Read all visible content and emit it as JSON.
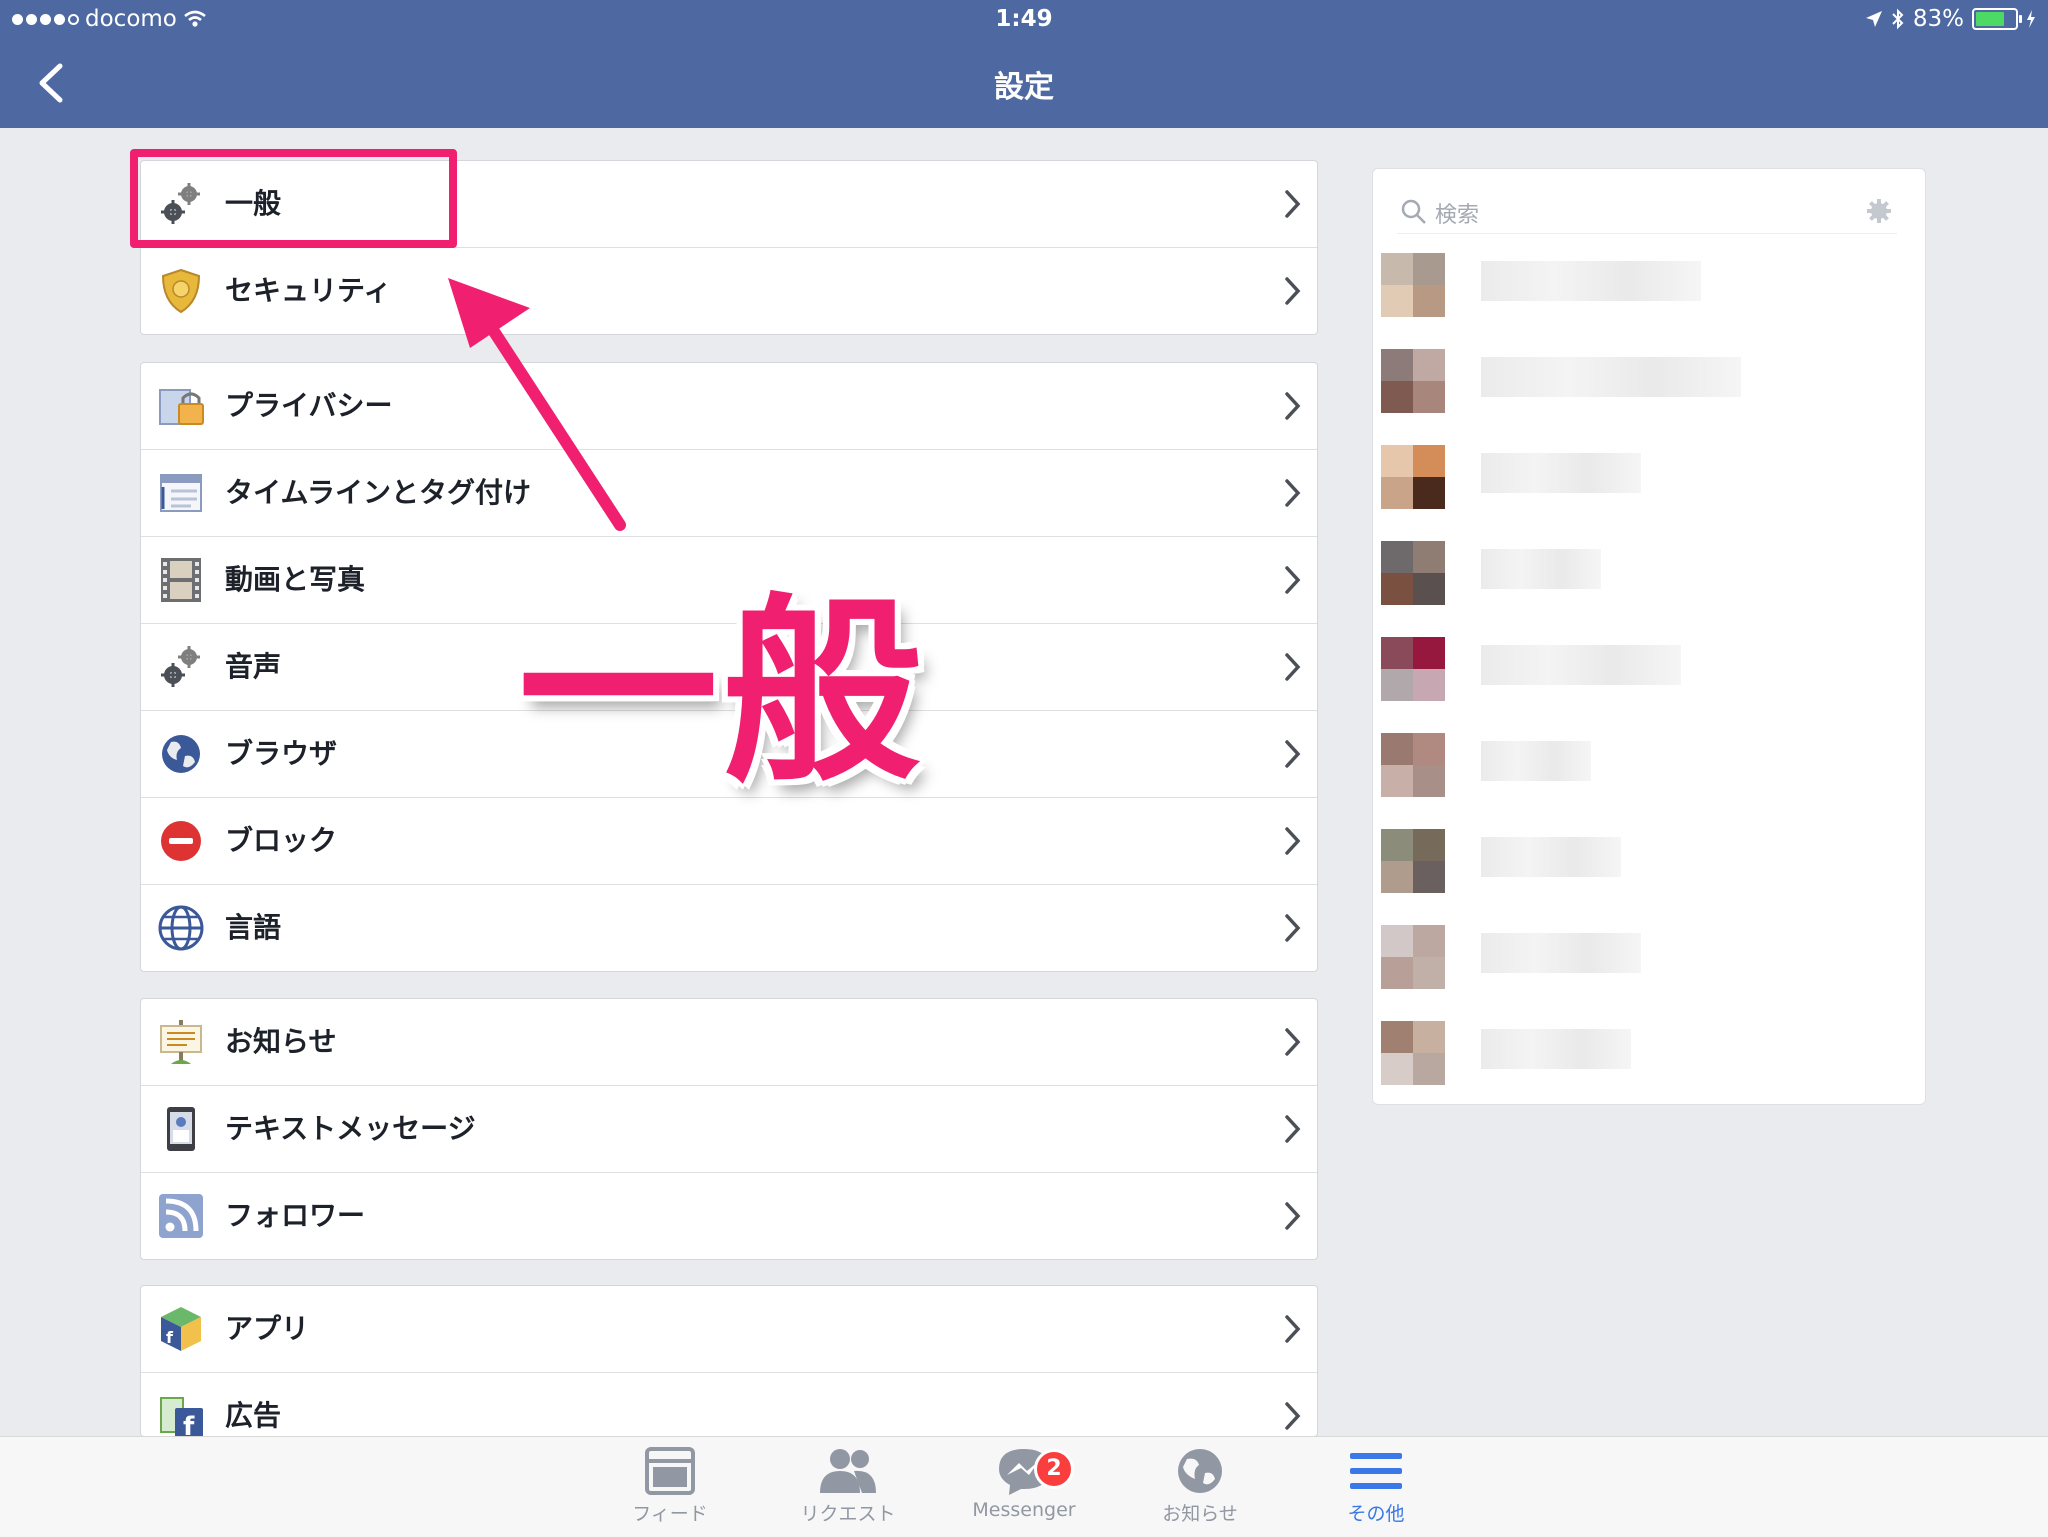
{
  "status_bar": {
    "carrier": "docomo",
    "time": "1:49",
    "battery": "83%",
    "battery_level": 0.83
  },
  "nav": {
    "title": "設定",
    "back_icon": "chevron-left-icon"
  },
  "settings_groups": [
    [
      {
        "label": "一般",
        "icon": "gears-icon"
      },
      {
        "label": "セキュリティ",
        "icon": "shield-badge-icon"
      }
    ],
    [
      {
        "label": "プライバシー",
        "icon": "privacy-lock-icon"
      },
      {
        "label": "タイムラインとタグ付け",
        "icon": "timeline-icon"
      },
      {
        "label": "動画と写真",
        "icon": "film-icon"
      },
      {
        "label": "音声",
        "icon": "gears-icon"
      },
      {
        "label": "ブラウザ",
        "icon": "globe-icon"
      },
      {
        "label": "ブロック",
        "icon": "block-icon"
      },
      {
        "label": "言語",
        "icon": "language-globe-icon"
      }
    ],
    [
      {
        "label": "お知らせ",
        "icon": "notice-board-icon"
      },
      {
        "label": "テキストメッセージ",
        "icon": "phone-icon"
      },
      {
        "label": "フォロワー",
        "icon": "rss-icon"
      }
    ],
    [
      {
        "label": "アプリ",
        "icon": "app-cube-icon"
      },
      {
        "label": "広告",
        "icon": "ad-icon"
      }
    ]
  ],
  "friends_panel": {
    "search_placeholder": "検索"
  },
  "annotation": {
    "big_text": "一般"
  },
  "tabbar": {
    "items": [
      {
        "label": "フィード",
        "icon": "feed-icon"
      },
      {
        "label": "リクエスト",
        "icon": "friend-requests-icon"
      },
      {
        "label": "Messenger",
        "icon": "messenger-icon",
        "badge": "2"
      },
      {
        "label": "お知らせ",
        "icon": "globe-notifications-icon"
      },
      {
        "label": "その他",
        "icon": "menu-icon",
        "active": true
      }
    ]
  },
  "colors": {
    "nav_bg": "#4e69a2",
    "page_bg": "#e9ebee",
    "annotation": "#f01f6f",
    "active_tab": "#3b78e7"
  }
}
